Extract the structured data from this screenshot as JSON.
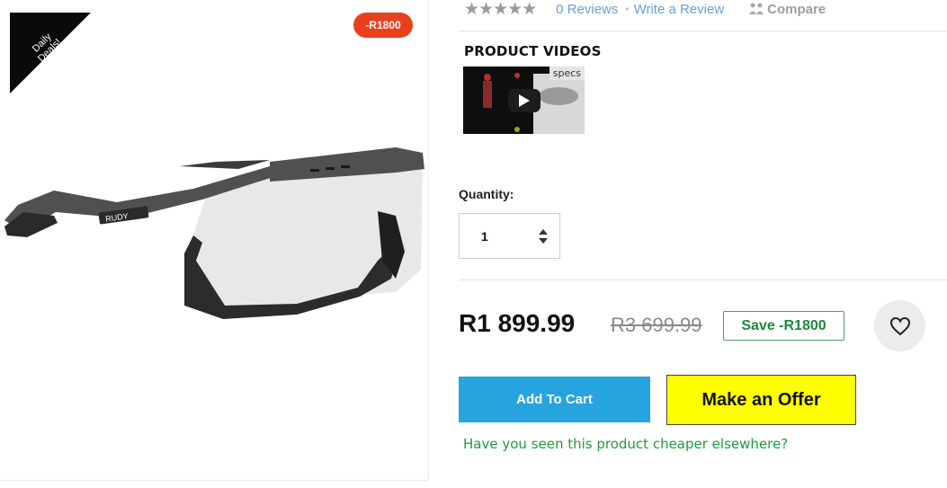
{
  "product_image": {
    "ribbon_text": "Daily Deals!",
    "discount_pill": "-R1800",
    "brand_on_frame": "RUDY"
  },
  "rating": {
    "stars": "★★★★★",
    "reviews_link": "0 Reviews",
    "separator": "•",
    "write_review": "Write a Review",
    "compare": "Compare"
  },
  "videos": {
    "heading": "PRODUCT VIDEOS",
    "thumb_label": "specs"
  },
  "quantity": {
    "label": "Quantity:",
    "value": "1"
  },
  "pricing": {
    "current": "R1 899.99",
    "original": "R3 699.99",
    "save_badge": "Save -R1800"
  },
  "actions": {
    "add_to_cart": "Add To Cart",
    "make_offer": "Make an Offer",
    "cheaper_link": "Have you seen this product cheaper elsewhere?"
  },
  "colors": {
    "accent_blue": "#26a4df",
    "offer_yellow": "#ffff00",
    "pill_red": "#e8401c",
    "save_green": "#1a8a3a",
    "link_blue": "#69a0d6"
  }
}
